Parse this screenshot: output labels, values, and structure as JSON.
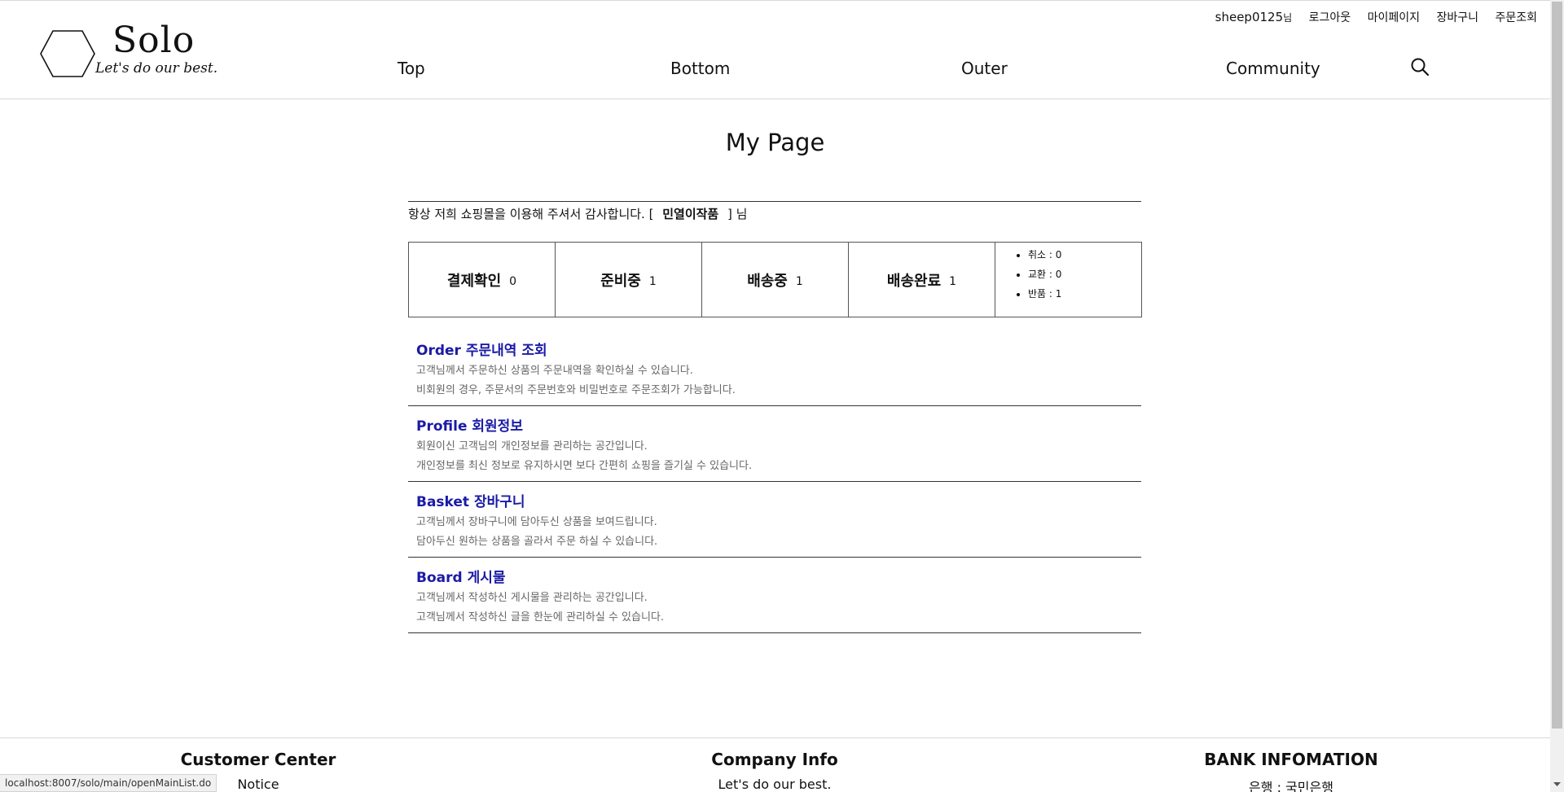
{
  "header": {
    "logo": {
      "title": "Solo",
      "tagline": "Let's do our best."
    },
    "utility": {
      "user_id": "sheep0125",
      "suffix": "님",
      "logout": "로그아웃",
      "mypage": "마이페이지",
      "cart": "장바구니",
      "orders": "주문조회"
    },
    "nav": [
      "Top",
      "Bottom",
      "Outer",
      "Community"
    ],
    "search_icon": "search-icon"
  },
  "main": {
    "title": "My Page",
    "welcome": {
      "prefix": "항상 저희 쇼핑몰을 이용해 주셔서 감사합니다. [",
      "name": "민열이작품",
      "suffix": "] 님"
    },
    "status": [
      {
        "label": "결제확인",
        "count": "0"
      },
      {
        "label": "준비중",
        "count": "1"
      },
      {
        "label": "배송중",
        "count": "1"
      },
      {
        "label": "배송완료",
        "count": "1"
      }
    ],
    "status_extra": [
      "취소 : 0",
      "교환 : 0",
      "반품 : 1"
    ],
    "menu": [
      {
        "title": "Order 주문내역 조회",
        "line1": "고객님께서 주문하신 상품의 주문내역을 확인하실 수 있습니다.",
        "line2": "비회원의 경우, 주문서의 주문번호와 비밀번호로 주문조회가 가능합니다."
      },
      {
        "title": "Profile 회원정보",
        "line1": "회원이신 고객님의 개인정보를 관리하는 공간입니다.",
        "line2": "개인정보를 최신 정보로 유지하시면 보다 간편히 쇼핑을 즐기실 수 있습니다."
      },
      {
        "title": "Basket 장바구니",
        "line1": "고객님께서 장바구니에 담아두신 상품을 보여드립니다.",
        "line2": "담아두신 원하는 상품을 골라서 주문 하실 수 있습니다."
      },
      {
        "title": "Board 게시물",
        "line1": "고객님께서 작성하신 게시물을 관리하는 공간입니다.",
        "line2": "고객님께서 작성하신 글을 한눈에 관리하실 수 있습니다."
      }
    ]
  },
  "footer": {
    "customer_center": {
      "title": "Customer Center",
      "sub": "Notice"
    },
    "company_info": {
      "title": "Company Info",
      "sub": "Let's do our best."
    },
    "bank": {
      "title": "BANK INFOMATION",
      "sub": "은행 : 국민은행"
    }
  },
  "status_bar_url": "localhost:8007/solo/main/openMainList.do"
}
